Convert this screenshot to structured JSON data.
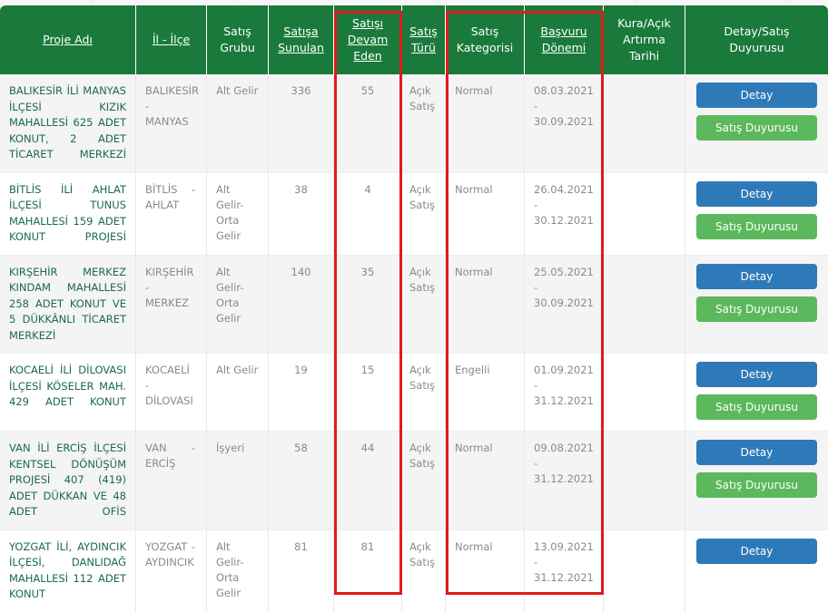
{
  "colors": {
    "header_green": "#1a7a3c",
    "detail_button_blue": "#2e7ab8",
    "announcement_button_green": "#5cb85c",
    "highlight_red": "#e01b1b",
    "project_text_green": "#1a6b4a",
    "cell_text_gray": "#8a8a8a"
  },
  "table": {
    "columns": [
      {
        "label": "Proje Adı",
        "sortable": true
      },
      {
        "label": "İl - İlçe",
        "sortable": true
      },
      {
        "label": "Satış\nGrubu",
        "sortable": false
      },
      {
        "label": "Satışa\nSunulan",
        "sortable": true
      },
      {
        "label": "Satışı\nDevam\nEden",
        "sortable": true
      },
      {
        "label": "Satış\nTürü",
        "sortable": true
      },
      {
        "label": "Satış\nKategorisi",
        "sortable": false
      },
      {
        "label": "Başvuru\nDönemi",
        "sortable": true
      },
      {
        "label": "Kura/Açık\nArtırma\nTarihi",
        "sortable": false
      },
      {
        "label": "Detay/Satış\nDuyurusu",
        "sortable": false
      }
    ],
    "header_labels": {
      "proje_adi": "Proje Adı",
      "il_ilce": "İl - İlçe",
      "satis_grubu_l1": "Satış",
      "satis_grubu_l2": "Grubu",
      "satisa_sunulan_l1": "Satışa",
      "satisa_sunulan_l2": "Sunulan",
      "satisi_devam_eden_l1": "Satışı",
      "satisi_devam_eden_l2": "Devam",
      "satisi_devam_eden_l3": "Eden",
      "satis_turu_l1": "Satış",
      "satis_turu_l2": "Türü",
      "satis_kategorisi_l1": "Satış",
      "satis_kategorisi_l2": "Kategorisi",
      "basvuru_donemi_l1": "Başvuru",
      "basvuru_donemi_l2": "Dönemi",
      "kura_acik_artirma_tarihi_l1": "Kura/Açık",
      "kura_acik_artirma_tarihi_l2": "Artırma",
      "kura_acik_artirma_tarihi_l3": "Tarihi",
      "detay_satis_duyurusu_l1": "Detay/Satış",
      "detay_satis_duyurusu_l2": "Duyurusu"
    },
    "rows": [
      {
        "proje_adi": "BALIKESİR İLİ MANYAS İLÇESİ KIZIK MAHALLESİ 625 ADET KONUT, 2 ADET TİCARET MERKEZİ",
        "il_ilce": "BALIKESİR - MANYAS",
        "satis_grubu": "Alt Gelir",
        "satisa_sunulan": "336",
        "satisi_devam_eden": "55",
        "satis_turu": "Açık Satış",
        "satis_kategorisi": "Normal",
        "basvuru_donemi": "08.03.2021 - 30.09.2021",
        "kura_acik_artirma_tarihi": "",
        "detay_button": "Detay",
        "duyuru_button": "Satış Duyurusu",
        "has_duyuru": true
      },
      {
        "proje_adi": "BİTLİS İLİ AHLAT İLÇESİ TUNUS MAHALLESİ 159 ADET KONUT PROJESİ",
        "il_ilce": "BİTLİS - AHLAT",
        "satis_grubu": "Alt Gelir-Orta Gelir",
        "satisa_sunulan": "38",
        "satisi_devam_eden": "4",
        "satis_turu": "Açık Satış",
        "satis_kategorisi": "Normal",
        "basvuru_donemi": "26.04.2021 - 30.12.2021",
        "kura_acik_artirma_tarihi": "",
        "detay_button": "Detay",
        "duyuru_button": "Satış Duyurusu",
        "has_duyuru": true
      },
      {
        "proje_adi": "KIRŞEHİR MERKEZ KINDAM MAHALLESİ 258 ADET KONUT VE 5 DÜKKÂNLI TİCARET MERKEZİ",
        "il_ilce": "KIRŞEHİR - MERKEZ",
        "satis_grubu": "Alt Gelir-Orta Gelir",
        "satisa_sunulan": "140",
        "satisi_devam_eden": "35",
        "satis_turu": "Açık Satış",
        "satis_kategorisi": "Normal",
        "basvuru_donemi": "25.05.2021 - 30.09.2021",
        "kura_acik_artirma_tarihi": "",
        "detay_button": "Detay",
        "duyuru_button": "Satış Duyurusu",
        "has_duyuru": true
      },
      {
        "proje_adi": "KOCAELİ İLİ DİLOVASI İLÇESİ KÖSELER MAH. 429 ADET KONUT",
        "il_ilce": "KOCAELİ - DİLOVASI",
        "satis_grubu": "Alt Gelir",
        "satisa_sunulan": "19",
        "satisi_devam_eden": "15",
        "satis_turu": "Açık Satış",
        "satis_kategorisi": "Engelli",
        "basvuru_donemi": "01.09.2021 - 31.12.2021",
        "kura_acik_artirma_tarihi": "",
        "detay_button": "Detay",
        "duyuru_button": "Satış Duyurusu",
        "has_duyuru": true
      },
      {
        "proje_adi": "VAN İLİ ERCİŞ İLÇESİ KENTSEL DÖNÜŞÜM PROJESİ 407 (419) ADET DÜKKAN VE 48 ADET OFİS",
        "il_ilce": "VAN - ERCİŞ",
        "satis_grubu": "İşyeri",
        "satisa_sunulan": "58",
        "satisi_devam_eden": "44",
        "satis_turu": "Açık Satış",
        "satis_kategorisi": "Normal",
        "basvuru_donemi": "09.08.2021 - 31.12.2021",
        "kura_acik_artirma_tarihi": "",
        "detay_button": "Detay",
        "duyuru_button": "Satış Duyurusu",
        "has_duyuru": true
      },
      {
        "proje_adi": "YOZGAT İLİ, AYDINCIK İLÇESİ, DANLIDAĞ MAHALLESİ 112 ADET KONUT",
        "il_ilce": "YOZGAT - AYDINCIK",
        "satis_grubu": "Alt Gelir-Orta Gelir",
        "satisa_sunulan": "81",
        "satisi_devam_eden": "81",
        "satis_turu": "Açık Satış",
        "satis_kategorisi": "Normal",
        "basvuru_donemi": "13.09.2021 - 31.12.2021",
        "kura_acik_artirma_tarihi": "",
        "detay_button": "Detay",
        "duyuru_button": "",
        "has_duyuru": false
      }
    ]
  },
  "annotations": [
    {
      "name": "satisi-devam-eden-highlight",
      "color": "#e01b1b",
      "targets_column": "Satışı Devam Eden"
    },
    {
      "name": "kategori-basvuru-highlight",
      "color": "#e01b1b",
      "targets_column": "Satış Kategorisi / Başvuru Dönemi"
    }
  ]
}
